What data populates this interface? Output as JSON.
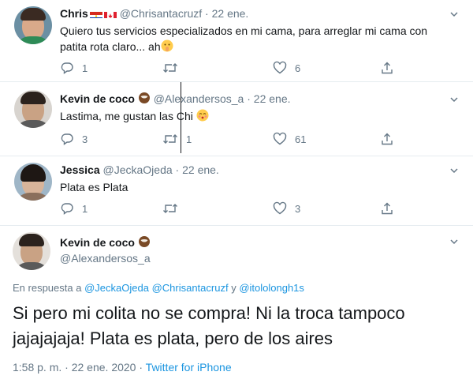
{
  "replies": [
    {
      "name": "Chris",
      "handle": "@Chrisantacruzf",
      "dot": "·",
      "date": "22 ene.",
      "text_line1": "Quiero tus servicios especializados en mi cama, para arreglar mi cama con",
      "text_line2": "patita rota claro... ah",
      "reply_count": "1",
      "retweet_count": "",
      "like_count": "6",
      "colors": {
        "skin": "#d9a98a",
        "hair": "#3a2a22",
        "body": "#2e8b57",
        "bg": "#6b8fa3"
      }
    },
    {
      "name": "Kevin de coco",
      "handle": "@Alexandersos_a",
      "dot": "·",
      "date": "22 ene.",
      "text_line1": "Lastima, me gustan las Chi",
      "reply_count": "3",
      "retweet_count": "1",
      "like_count": "61",
      "colors": {
        "skin": "#c9a284",
        "hair": "#2b221d",
        "body": "#5a5a5a",
        "bg": "#d8d4cf"
      }
    },
    {
      "name": "Jessica",
      "handle": "@JeckaOjeda",
      "dot": "·",
      "date": "22 ene.",
      "text_line1": "Plata es Plata",
      "reply_count": "1",
      "retweet_count": "",
      "like_count": "3",
      "colors": {
        "skin": "#d8b49a",
        "hair": "#1e1714",
        "body": "#8a6f5c",
        "bg": "#9fb6c7"
      }
    }
  ],
  "main": {
    "name": "Kevin de coco",
    "handle": "@Alexandersos_a",
    "reply_prefix": "En respuesta a",
    "reply_user1": "@JeckaOjeda",
    "reply_user2": "@Chrisantacruzf",
    "reply_and": "y",
    "reply_user3": "@itololongh1s",
    "text_line1": "Si pero mi colita no se compra! Ni la troca tampoco",
    "text_line2": "jajajajaja! Plata es plata, pero de los aires",
    "time": "1:58 p. m.",
    "meta_dot": "·",
    "date": "22 ene. 2020",
    "source": "Twitter for iPhone"
  },
  "icons": [
    "reply-icon",
    "retweet-icon",
    "like-icon",
    "share-icon",
    "chevron-down-icon",
    "coconut-emoji",
    "flag-paraguay",
    "flag-canada",
    "kiss-emoji",
    "shush-emoji"
  ]
}
